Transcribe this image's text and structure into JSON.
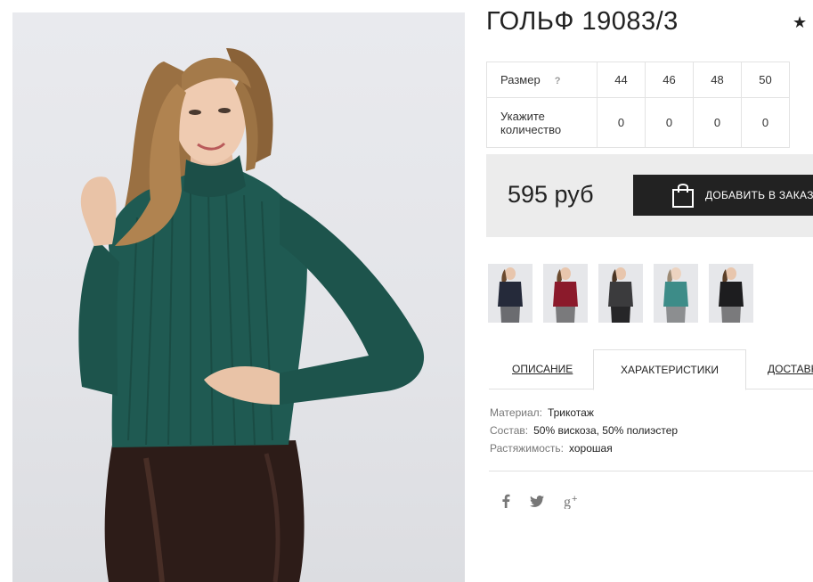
{
  "product": {
    "title": "ГОЛЬФ 19083/3"
  },
  "rating_icon": "star-icon",
  "sizes": {
    "size_label": "Размер",
    "help_mark": "?",
    "qty_label": "Укажите количество",
    "values": [
      "44",
      "46",
      "48",
      "50"
    ],
    "quantities": [
      "0",
      "0",
      "0",
      "0"
    ]
  },
  "buy": {
    "price": "595 руб",
    "add_button": "ДОБАВИТЬ В ЗАКАЗ",
    "button_icon": "shopping-bag-icon"
  },
  "thumbnails": [
    {
      "color": "navy",
      "hex": "#252a3a"
    },
    {
      "color": "burgundy",
      "hex": "#8b1a2b"
    },
    {
      "color": "dark-grey",
      "hex": "#3b3b3d"
    },
    {
      "color": "teal",
      "hex": "#3d8c88"
    },
    {
      "color": "black",
      "hex": "#1d1d1f"
    }
  ],
  "tabs": [
    "ОПИСАНИЕ",
    "ХАРАКТЕРИСТИКИ",
    "ДОСТАВКА"
  ],
  "active_tab": "ХАРАКТЕРИСТИКИ",
  "specs": [
    {
      "key": "Материал:",
      "value": "Трикотаж"
    },
    {
      "key": "Состав:",
      "value": "50% вискоза, 50% полиэстер"
    },
    {
      "key": "Растяжимость:",
      "value": "хорошая"
    }
  ],
  "social": [
    "facebook-icon",
    "twitter-icon",
    "google-plus-icon"
  ],
  "colors": {
    "button_bg": "#222222",
    "price_box": "#ececec",
    "sweater": "#1f5a52"
  }
}
